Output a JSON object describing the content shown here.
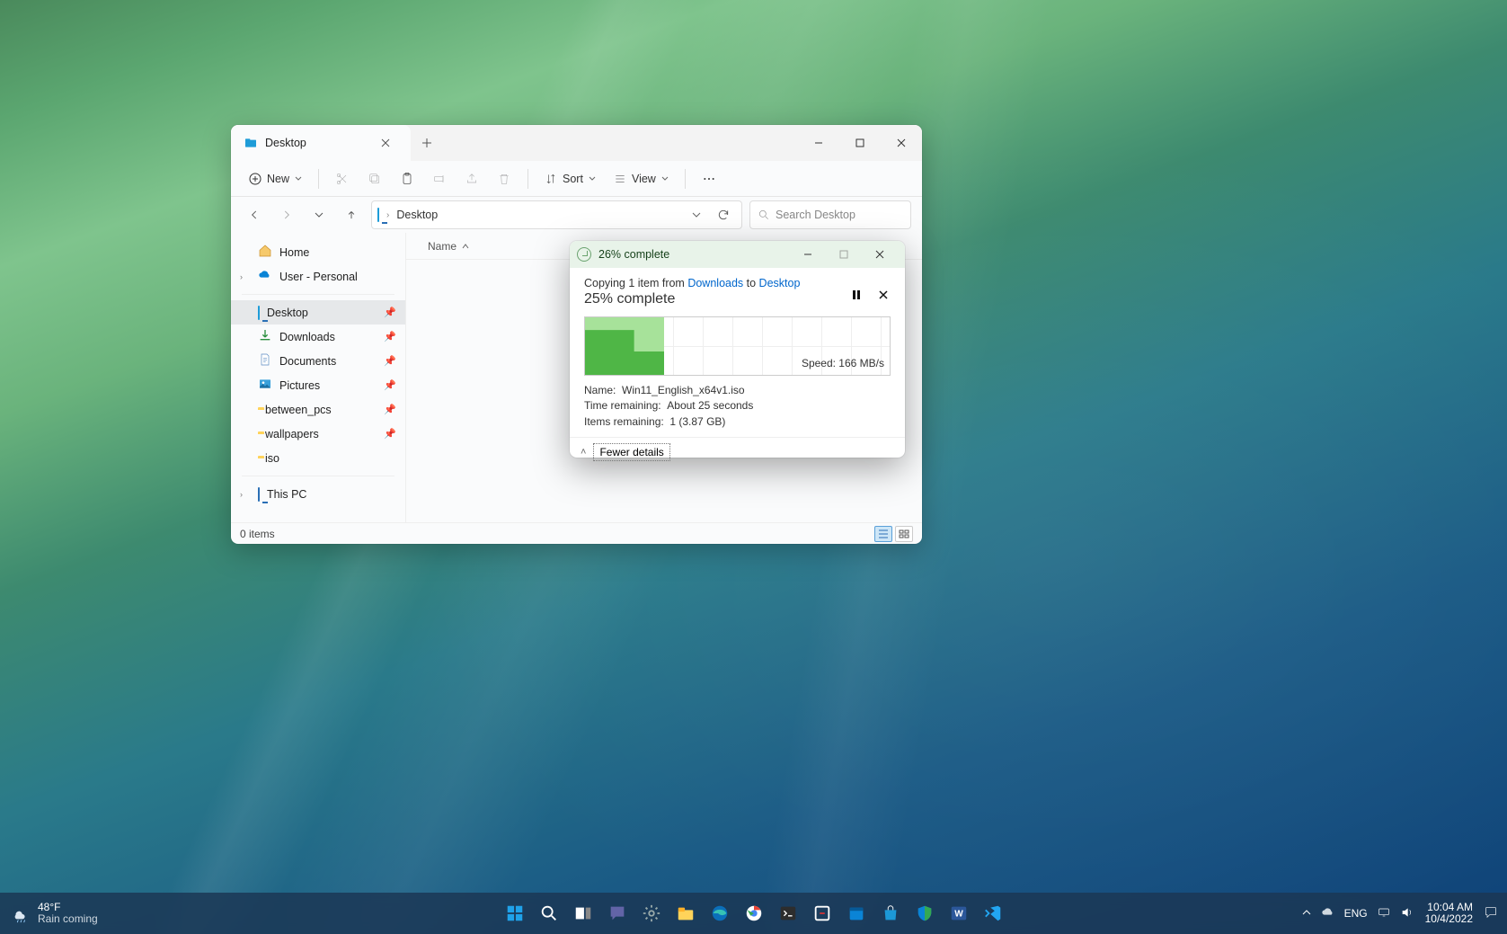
{
  "explorer": {
    "tab_title": "Desktop",
    "toolbar": {
      "new": "New",
      "sort": "Sort",
      "view": "View"
    },
    "breadcrumb": "Desktop",
    "search_placeholder": "Search Desktop",
    "columns": {
      "name": "Name"
    },
    "sidebar": {
      "home": "Home",
      "user": "User - Personal",
      "pins": [
        "Desktop",
        "Downloads",
        "Documents",
        "Pictures",
        "between_pcs",
        "wallpapers",
        "iso"
      ],
      "thispc": "This PC"
    },
    "status": "0 items"
  },
  "copy": {
    "title": "26% complete",
    "line_prefix": "Copying 1 item from ",
    "from": "Downloads",
    "to_word": " to ",
    "to": "Desktop",
    "percent": "25% complete",
    "speed": "Speed: 166 MB/s",
    "name_label": "Name:",
    "name_value": "Win11_English_x64v1.iso",
    "time_label": "Time remaining:",
    "time_value": "About 25 seconds",
    "items_label": "Items remaining:",
    "items_value": "1 (3.87 GB)",
    "fewer": "Fewer details"
  },
  "taskbar": {
    "temp": "48°F",
    "weather": "Rain coming",
    "lang": "ENG",
    "time": "10:04 AM",
    "date": "10/4/2022"
  }
}
